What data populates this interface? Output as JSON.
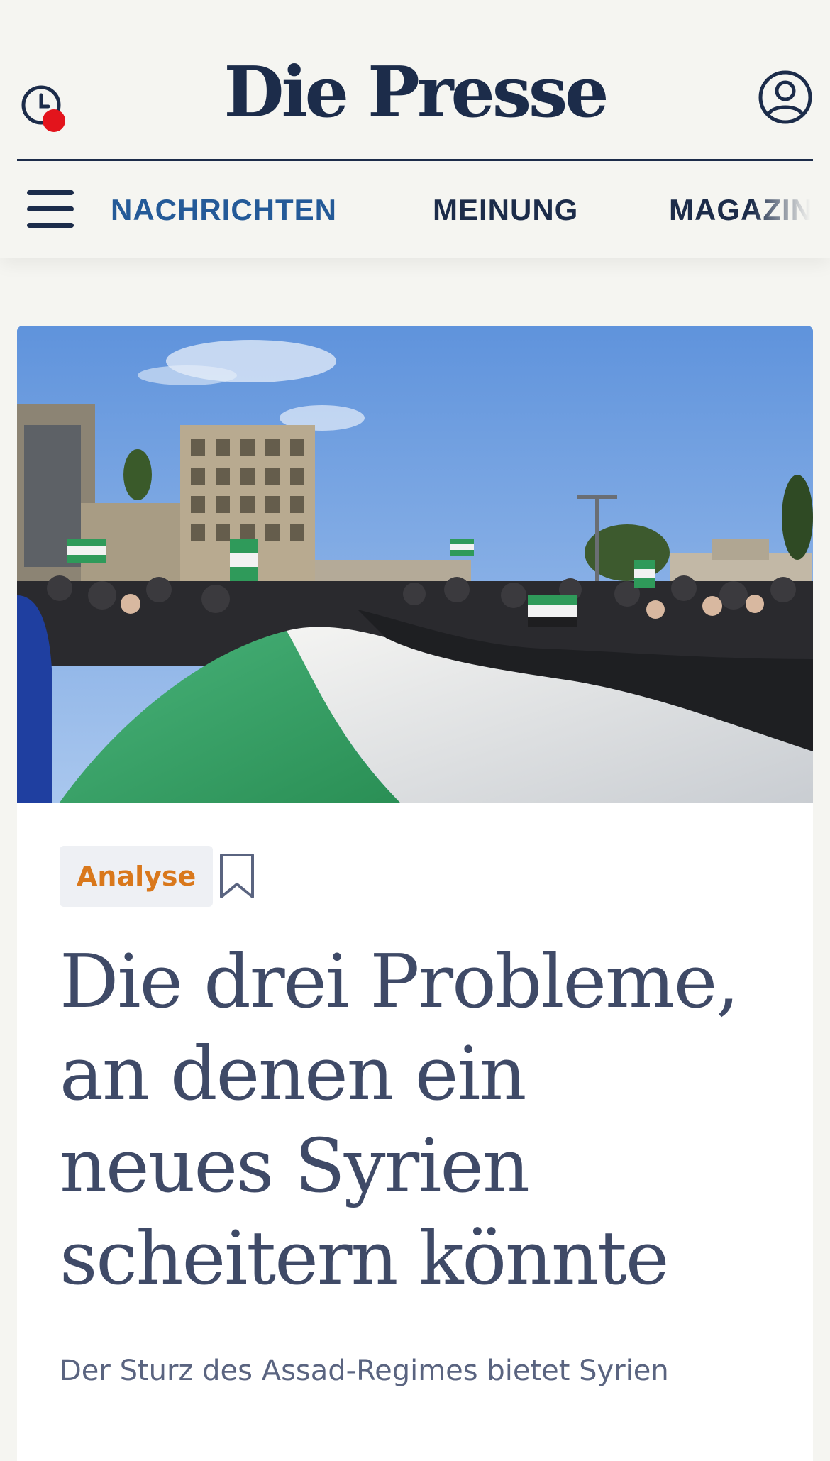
{
  "header": {
    "logo": "Die Presse",
    "history_icon": "clock-icon",
    "notification_color": "#e3141c",
    "account_icon": "user-icon",
    "menu_icon": "hamburger-icon"
  },
  "nav": {
    "items": [
      {
        "label": "NACHRICHTEN",
        "active": true
      },
      {
        "label": "MEINUNG",
        "active": false
      },
      {
        "label": "MAGAZIN",
        "active": false
      }
    ]
  },
  "article": {
    "tag": "Analyse",
    "bookmark_icon": "bookmark-icon",
    "headline_lines": [
      "Die drei Probleme,",
      "an denen ein",
      "neues Syrien",
      "scheitern könnte"
    ],
    "lead": "Der Sturz des Assad-Regimes bietet Syrien",
    "image_alt": "Demonstranten mit einer großen syrischen Oppositionsflagge"
  },
  "colors": {
    "brand": "#1c2c4a",
    "nav_active": "#245a98",
    "tag_text": "#d9781c",
    "headline": "#3f4a67"
  }
}
